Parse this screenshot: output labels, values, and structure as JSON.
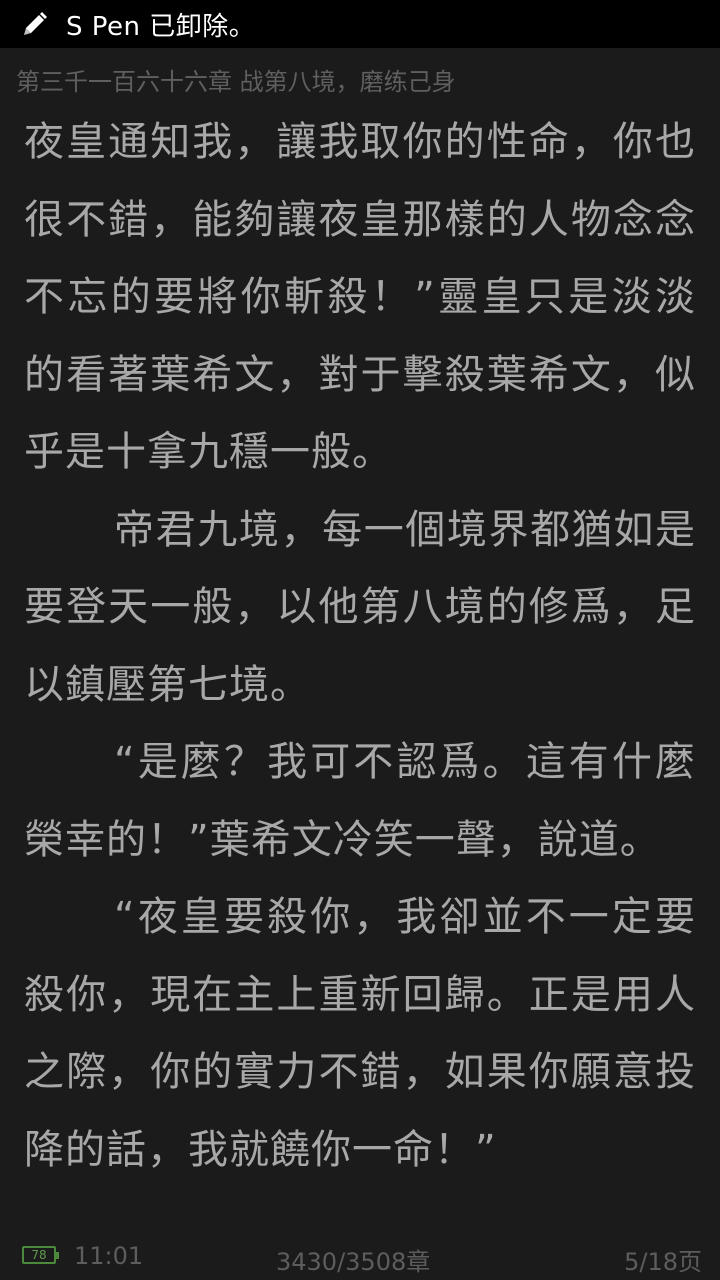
{
  "notification": {
    "icon": "pen-icon",
    "text": "S Pen 已卸除。",
    "background": "#000000",
    "text_color": "#ffffff"
  },
  "reader": {
    "background": "#1b1b1b",
    "chapter_title": "第三千一百六十六章 战第八境，磨练己身",
    "paragraphs": [
      {
        "indent": false,
        "text": "夜皇通知我，讓我取你的性命，你也很不錯，能夠讓夜皇那樣的人物念念不忘的要將你斬殺！”靈皇只是淡淡的看著葉希文，對于擊殺葉希文，似乎是十拿九穩一般。"
      },
      {
        "indent": true,
        "text": "帝君九境，每一個境界都猶如是要登天一般，以他第八境的修爲，足以鎮壓第七境。"
      },
      {
        "indent": true,
        "text": "“是麼？我可不認爲。這有什麼榮幸的！”葉希文冷笑一聲，說道。"
      },
      {
        "indent": true,
        "text": "“夜皇要殺你，我卻並不一定要殺你，現在主上重新回歸。正是用人之際，你的實力不錯，如果你願意投降的話，我就饒你一命！”"
      }
    ]
  },
  "status_bar": {
    "battery_level": "78",
    "time": "11:01",
    "chapter_progress": "3430/3508章",
    "page": "5/18页",
    "battery_color": "#4a8a3a"
  }
}
